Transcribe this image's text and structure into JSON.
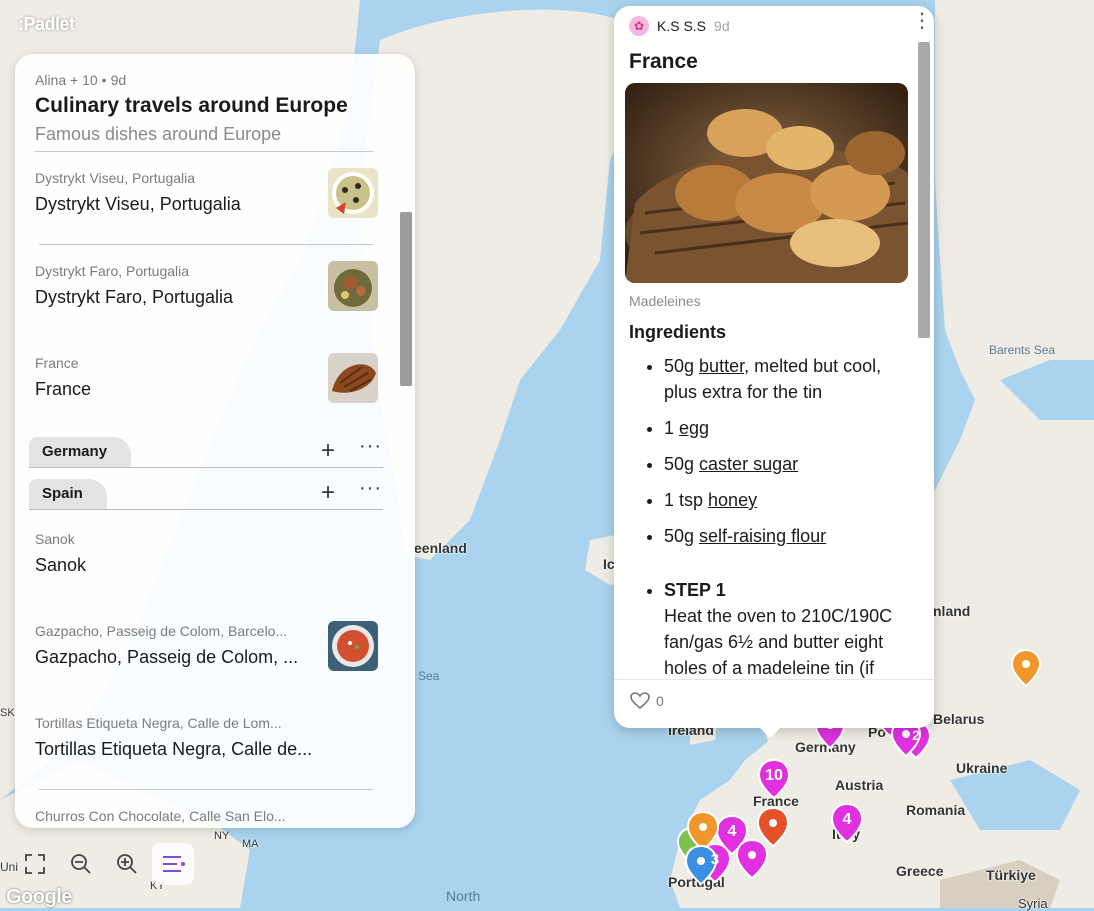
{
  "app": {
    "logo": ":Padlet"
  },
  "map": {
    "labels": {
      "barents_sea": "Barents Sea",
      "greenland": "eenland",
      "iceland": "Ic",
      "finland": "nland",
      "sea": "Sea",
      "ireland": "Ireland",
      "germany": "Germany",
      "belarus": "Belarus",
      "ukraine": "Ukraine",
      "austria": "Austria",
      "france": "France",
      "romania": "Romania",
      "italy": "Italy",
      "greece": "Greece",
      "turkiye": "Türkiye",
      "portugal": "Portugal",
      "north": "North",
      "sk": "SK",
      "ny": "NY",
      "ma": "MA",
      "ky": "KY",
      "po": "Po",
      "syria": "Syria",
      "uni": "Uni"
    },
    "pins": {
      "france_cluster": "10",
      "germany_cluster": "3",
      "italy_cluster": "4",
      "spain_cluster": "4",
      "portugal_cluster": "3",
      "poland_cluster": "2"
    },
    "pin_colors": {
      "magenta": "#e030e0",
      "orange": "#f0962d",
      "red": "#e5502a",
      "blue": "#3b8fe0",
      "green": "#7dc24a"
    }
  },
  "panel": {
    "author": "Alina + 10",
    "age": "9d",
    "title": "Culinary travels around Europe",
    "subtitle": "Famous dishes around Europe",
    "posts_top": [
      {
        "subject": "Dystrykt Viseu, Portugalia",
        "title": "Dystrykt Viseu, Portugalia"
      },
      {
        "subject": "Dystrykt Faro, Portugalia",
        "title": "Dystrykt Faro, Portugalia"
      },
      {
        "subject": "France",
        "title": "France"
      }
    ],
    "sections": [
      {
        "name": "Germany"
      },
      {
        "name": "Spain"
      }
    ],
    "posts_spain": [
      {
        "subject": "Sanok",
        "title": "Sanok"
      },
      {
        "subject": "Gazpacho, Passeig de Colom, Barcelo...",
        "title": "Gazpacho, Passeig de Colom, ..."
      },
      {
        "subject": "Tortillas Etiqueta Negra, Calle de Lom...",
        "title": "Tortillas Etiqueta Negra, Calle de..."
      },
      {
        "subject": "Churros Con Chocolate, Calle San Elo...",
        "title": ""
      }
    ],
    "plus": "+",
    "more": "···"
  },
  "toolbar": {
    "fullscreen": "fullscreen-icon",
    "zoom_out": "zoom-out-icon",
    "zoom_in": "zoom-in-icon",
    "list": "list-icon"
  },
  "google": "Google",
  "card": {
    "author": "K.S S.S",
    "age": "9d",
    "title": "France",
    "caption": "Madeleines",
    "ingredients_heading": "Ingredients",
    "ingredients": [
      {
        "pre": "50g ",
        "link": "butter,",
        "post": " melted but cool, plus extra for the tin"
      },
      {
        "pre": "1 ",
        "link": "egg",
        "post": ""
      },
      {
        "pre": "50g ",
        "link": "caster sugar",
        "post": ""
      },
      {
        "pre": "1 tsp ",
        "link": "honey",
        "post": ""
      },
      {
        "pre": "50g ",
        "link": "self-raising flour",
        "post": ""
      }
    ],
    "step_heading": "STEP 1",
    "step_text": "Heat the oven to 210C/190C fan/gas 6½ and butter eight holes of a madeleine tin (if",
    "likes": "0"
  }
}
